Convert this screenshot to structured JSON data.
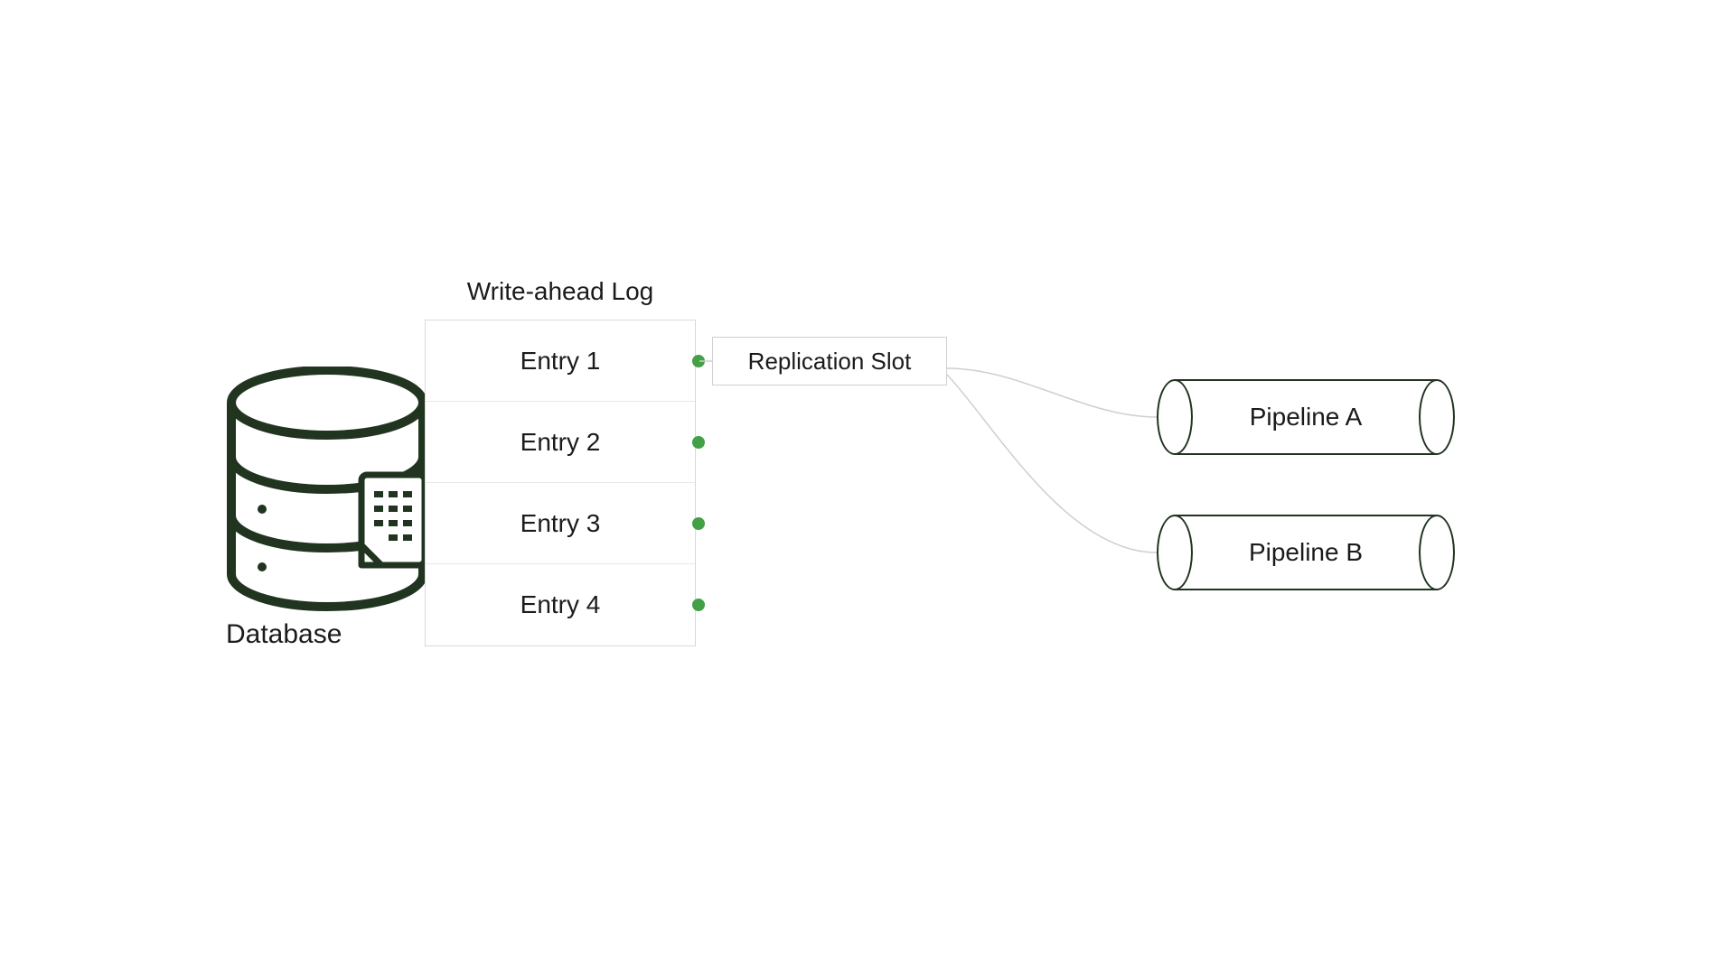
{
  "database": {
    "label": "Database"
  },
  "wal": {
    "title": "Write-ahead Log",
    "entries": [
      {
        "label": "Entry 1"
      },
      {
        "label": "Entry 2"
      },
      {
        "label": "Entry 3"
      },
      {
        "label": "Entry 4"
      }
    ]
  },
  "replication_slot": {
    "label": "Replication Slot"
  },
  "pipelines": [
    {
      "label": "Pipeline A"
    },
    {
      "label": "Pipeline B"
    }
  ],
  "colors": {
    "outline": "#20341f",
    "dot": "#43a047",
    "line": "#cfcfcf"
  }
}
